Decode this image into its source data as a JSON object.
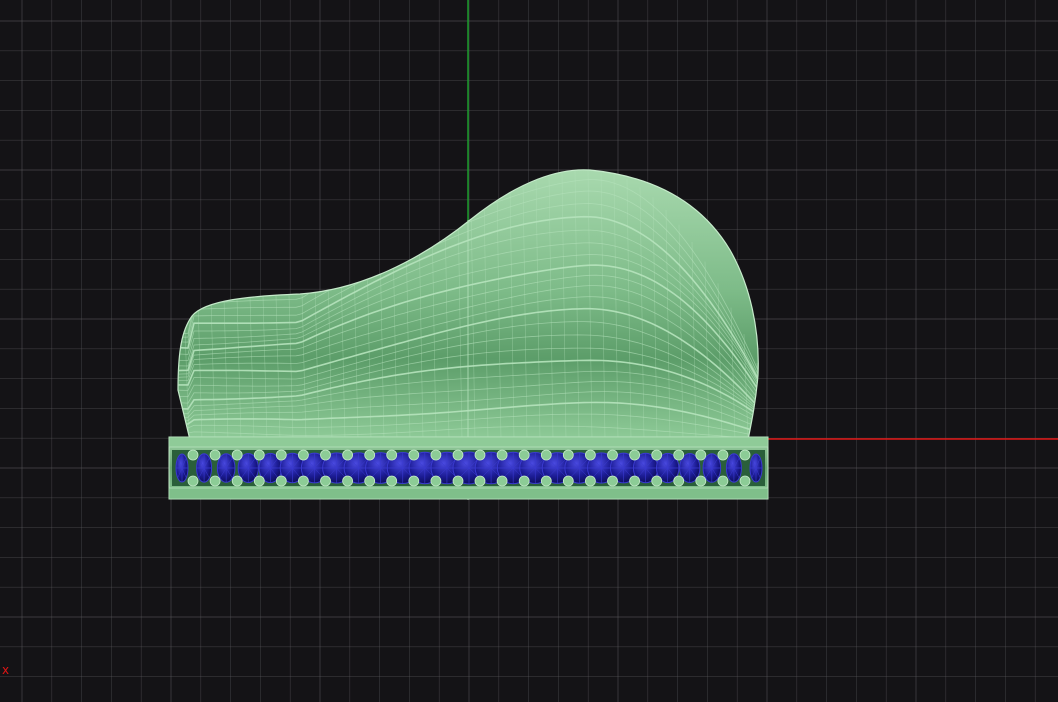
{
  "viewport": {
    "view": "front",
    "axis_label": "x",
    "colors": {
      "background": "#141316",
      "grid": "#5b5b5e",
      "x_axis": "#e01515",
      "y_axis": "#1a9b2a",
      "model_surface": "#7fc08f",
      "model_wire": "#b6e3bd",
      "gem_fill": "#1a1a8c",
      "gem_wire": "#3a3ad0",
      "prong": "#8ccc96"
    }
  },
  "model": {
    "name": "ring",
    "parts": [
      "shank",
      "gem-band"
    ],
    "gem_count": 27
  }
}
